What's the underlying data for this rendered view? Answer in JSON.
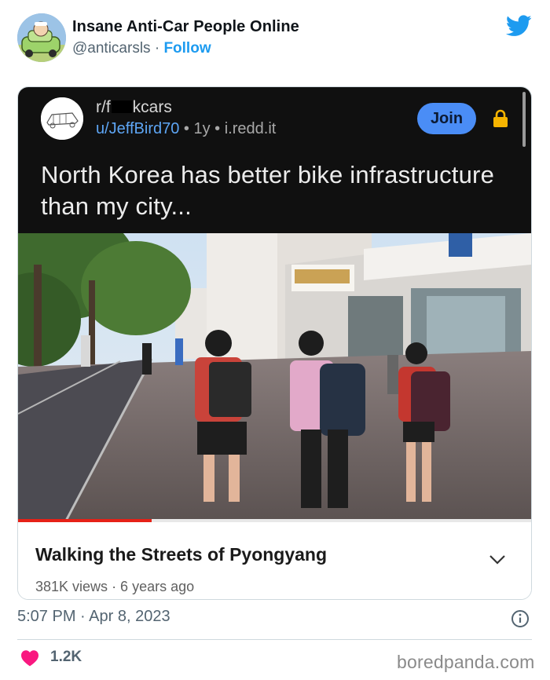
{
  "tweet": {
    "display_name": "Insane Anti-Car People Online",
    "handle": "@anticarsls",
    "separator": " · ",
    "follow_label": "Follow",
    "timestamp": "5:07 PM · Apr 8, 2023",
    "like_count": "1.2K",
    "icons": [
      "avatar",
      "twitter-bird-icon",
      "info-icon",
      "heart-icon"
    ]
  },
  "reddit_post": {
    "sub_prefix": "r/f",
    "sub_suffix": "kcars",
    "user": "u/JeffBird70",
    "age": " • 1y • ",
    "domain": "i.redd.it",
    "join_label": "Join",
    "title": "North Korea has better bike infrastructure than my city..."
  },
  "video": {
    "title": "Walking the Streets of Pyongyang",
    "views": "381K views",
    "age": " · 6 years ago",
    "progress_fraction": 0.26
  },
  "watermark": "boredpanda.com",
  "colors": {
    "follow_blue": "#1d9bf0",
    "join_blue": "#4a8df6",
    "lock_yellow": "#f6b400",
    "like_pink": "#f91880",
    "progress_red": "#e62117"
  }
}
